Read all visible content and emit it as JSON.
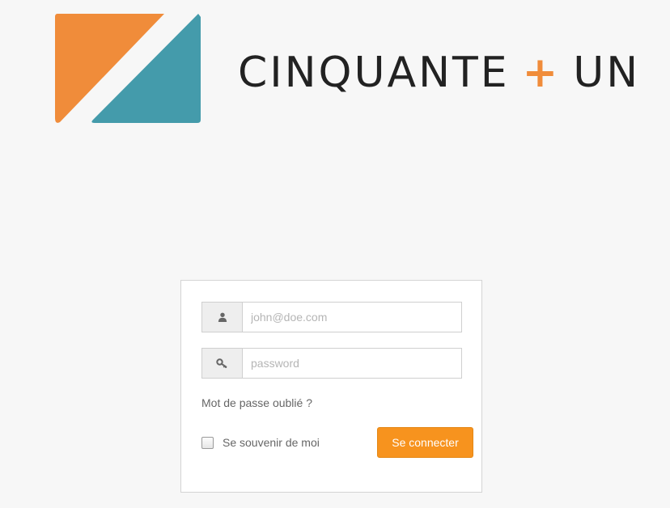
{
  "brand": {
    "name_left": "CINQUANTE",
    "plus": "+",
    "name_right": "UN",
    "logo_colors": {
      "orange": "#f08c3a",
      "teal": "#449bab"
    }
  },
  "login": {
    "email_placeholder": "john@doe.com",
    "password_placeholder": "password",
    "forgot_password": "Mot de passe oublié ?",
    "remember_me": "Se souvenir de moi",
    "submit": "Se connecter",
    "button_color": "#f7931e"
  },
  "icons": {
    "email_field": "user-icon",
    "password_field": "key-icon"
  }
}
